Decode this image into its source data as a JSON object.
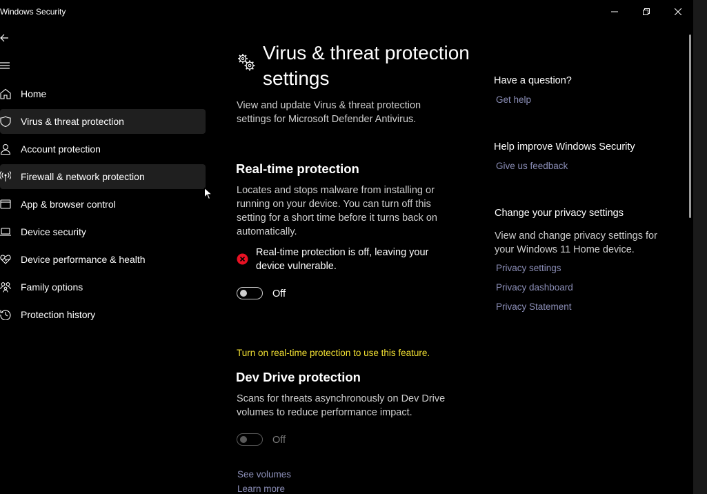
{
  "window": {
    "title": "Windows Security"
  },
  "nav": {
    "items": [
      {
        "label": "Home",
        "icon": "home-icon"
      },
      {
        "label": "Virus & threat protection",
        "icon": "shield-icon"
      },
      {
        "label": "Account protection",
        "icon": "person-icon"
      },
      {
        "label": "Firewall & network protection",
        "icon": "antenna-icon"
      },
      {
        "label": "App & browser control",
        "icon": "app-window-icon"
      },
      {
        "label": "Device security",
        "icon": "laptop-icon"
      },
      {
        "label": "Device performance & health",
        "icon": "heart-pulse-icon"
      },
      {
        "label": "Family options",
        "icon": "family-icon"
      },
      {
        "label": "Protection history",
        "icon": "history-icon"
      }
    ]
  },
  "main": {
    "title": "Virus & threat protection settings",
    "description": "View and update Virus & threat protection settings for Microsoft Defender Antivirus.",
    "realtime": {
      "title": "Real-time protection",
      "description": "Locates and stops malware from installing or running on your device. You can turn off this setting for a short time before it turns back on automatically.",
      "status": "Real-time protection is off, leaving your device vulnerable.",
      "toggle_state": "Off"
    },
    "devdrive": {
      "warning": "Turn on real-time protection to use this feature.",
      "title": "Dev Drive protection",
      "description": "Scans for threats asynchronously on Dev Drive volumes to reduce performance impact.",
      "toggle_state": "Off",
      "see_volumes": "See volumes",
      "learn_more": "Learn more"
    }
  },
  "right": {
    "question": {
      "title": "Have a question?",
      "link": "Get help"
    },
    "improve": {
      "title": "Help improve Windows Security",
      "link": "Give us feedback"
    },
    "privacy": {
      "title": "Change your privacy settings",
      "text": "View and change privacy settings for your Windows 11 Home device.",
      "links": [
        "Privacy settings",
        "Privacy dashboard",
        "Privacy Statement"
      ]
    }
  },
  "colors": {
    "background": "#000000",
    "warning": "#f3e133",
    "link": "#8c8fb8",
    "error": "#e81123"
  }
}
